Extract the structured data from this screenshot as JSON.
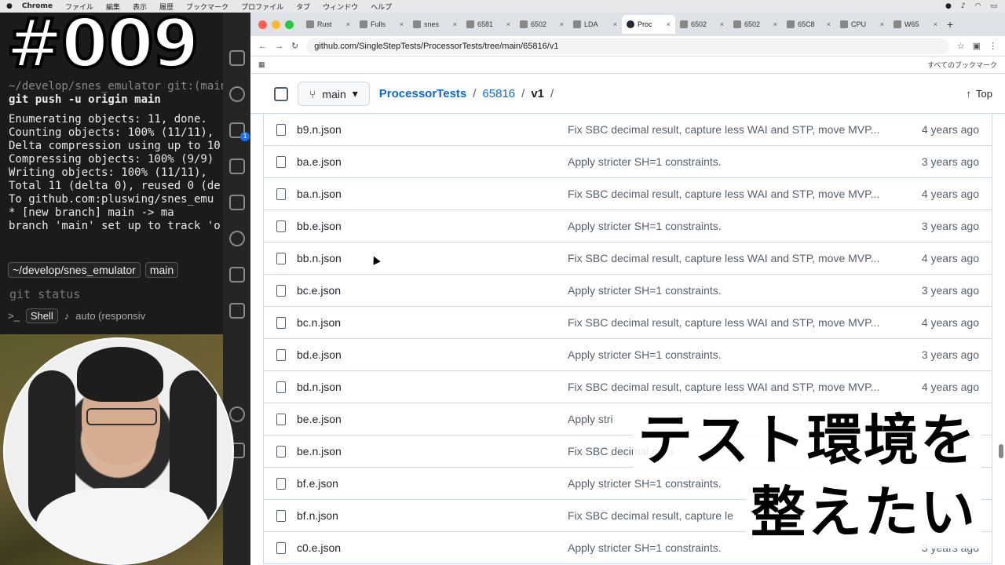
{
  "menubar": {
    "apple": "",
    "app": "Chrome",
    "items": [
      "ファイル",
      "編集",
      "表示",
      "履歴",
      "ブックマーク",
      "プロファイル",
      "タブ",
      "ウィンドウ",
      "ヘルプ"
    ]
  },
  "overlay": {
    "episode": "#009"
  },
  "terminal": {
    "prompt_line": "~/develop/snes_emulator git:(main)",
    "command": "git push -u origin main",
    "output": [
      "Enumerating objects: 11, done.",
      "Counting objects: 100% (11/11),",
      "Delta compression using up to 10",
      "Compressing objects: 100% (9/9)",
      "Writing objects: 100% (11/11),",
      "Total 11 (delta 0), reused 0 (de",
      "To github.com:pluswing/snes_emu",
      " * [new branch]      main -> ma",
      "branch 'main' set up to track 'o"
    ],
    "path_chip": "~/develop/snes_emulator",
    "branch_chip": "main",
    "status_placeholder": "git status",
    "shell_label": "Shell",
    "mode_label": "auto (responsiv"
  },
  "browser": {
    "tabs": [
      {
        "label": "Rust"
      },
      {
        "label": "Fulls"
      },
      {
        "label": "snes"
      },
      {
        "label": "6581"
      },
      {
        "label": "6502"
      },
      {
        "label": "LDA"
      },
      {
        "label": "Proc",
        "active": true
      },
      {
        "label": "6502"
      },
      {
        "label": "6502"
      },
      {
        "label": "65C8"
      },
      {
        "label": "CPU"
      },
      {
        "label": "W65"
      }
    ],
    "url": "github.com/SingleStepTests/ProcessorTests/tree/main/65816/v1",
    "bookmarks_label": "すべてのブックマーク"
  },
  "github": {
    "branch": "main",
    "breadcrumb": [
      "ProcessorTests",
      "65816",
      "v1"
    ],
    "top_label": "Top",
    "files": [
      {
        "name": "b9.n.json",
        "message": "Fix SBC decimal result, capture less WAI and STP, move MVP...",
        "date": "4 years ago"
      },
      {
        "name": "ba.e.json",
        "message": "Apply stricter SH=1 constraints.",
        "date": "3 years ago"
      },
      {
        "name": "ba.n.json",
        "message": "Fix SBC decimal result, capture less WAI and STP, move MVP...",
        "date": "4 years ago"
      },
      {
        "name": "bb.e.json",
        "message": "Apply stricter SH=1 constraints.",
        "date": "3 years ago"
      },
      {
        "name": "bb.n.json",
        "message": "Fix SBC decimal result, capture less WAI and STP, move MVP...",
        "date": "4 years ago"
      },
      {
        "name": "bc.e.json",
        "message": "Apply stricter SH=1 constraints.",
        "date": "3 years ago"
      },
      {
        "name": "bc.n.json",
        "message": "Fix SBC decimal result, capture less WAI and STP, move MVP...",
        "date": "4 years ago"
      },
      {
        "name": "bd.e.json",
        "message": "Apply stricter SH=1 constraints.",
        "date": "3 years ago"
      },
      {
        "name": "bd.n.json",
        "message": "Fix SBC decimal result, capture less WAI and STP, move MVP...",
        "date": "4 years ago"
      },
      {
        "name": "be.e.json",
        "message": "Apply stri",
        "date": ""
      },
      {
        "name": "be.n.json",
        "message": "Fix SBC decimal resu",
        "date": ""
      },
      {
        "name": "bf.e.json",
        "message": "Apply stricter SH=1 constraints.",
        "date": ""
      },
      {
        "name": "bf.n.json",
        "message": "Fix SBC decimal result, capture le",
        "date": ""
      },
      {
        "name": "c0.e.json",
        "message": "Apply stricter SH=1 constraints.",
        "date": "3 years ago"
      }
    ]
  },
  "caption": {
    "line1": "テスト環境を",
    "line2": "整えたい"
  },
  "colors": {
    "link": "#0969da",
    "text": "#1f2328",
    "muted": "#57606a",
    "border": "#d0d7de"
  }
}
